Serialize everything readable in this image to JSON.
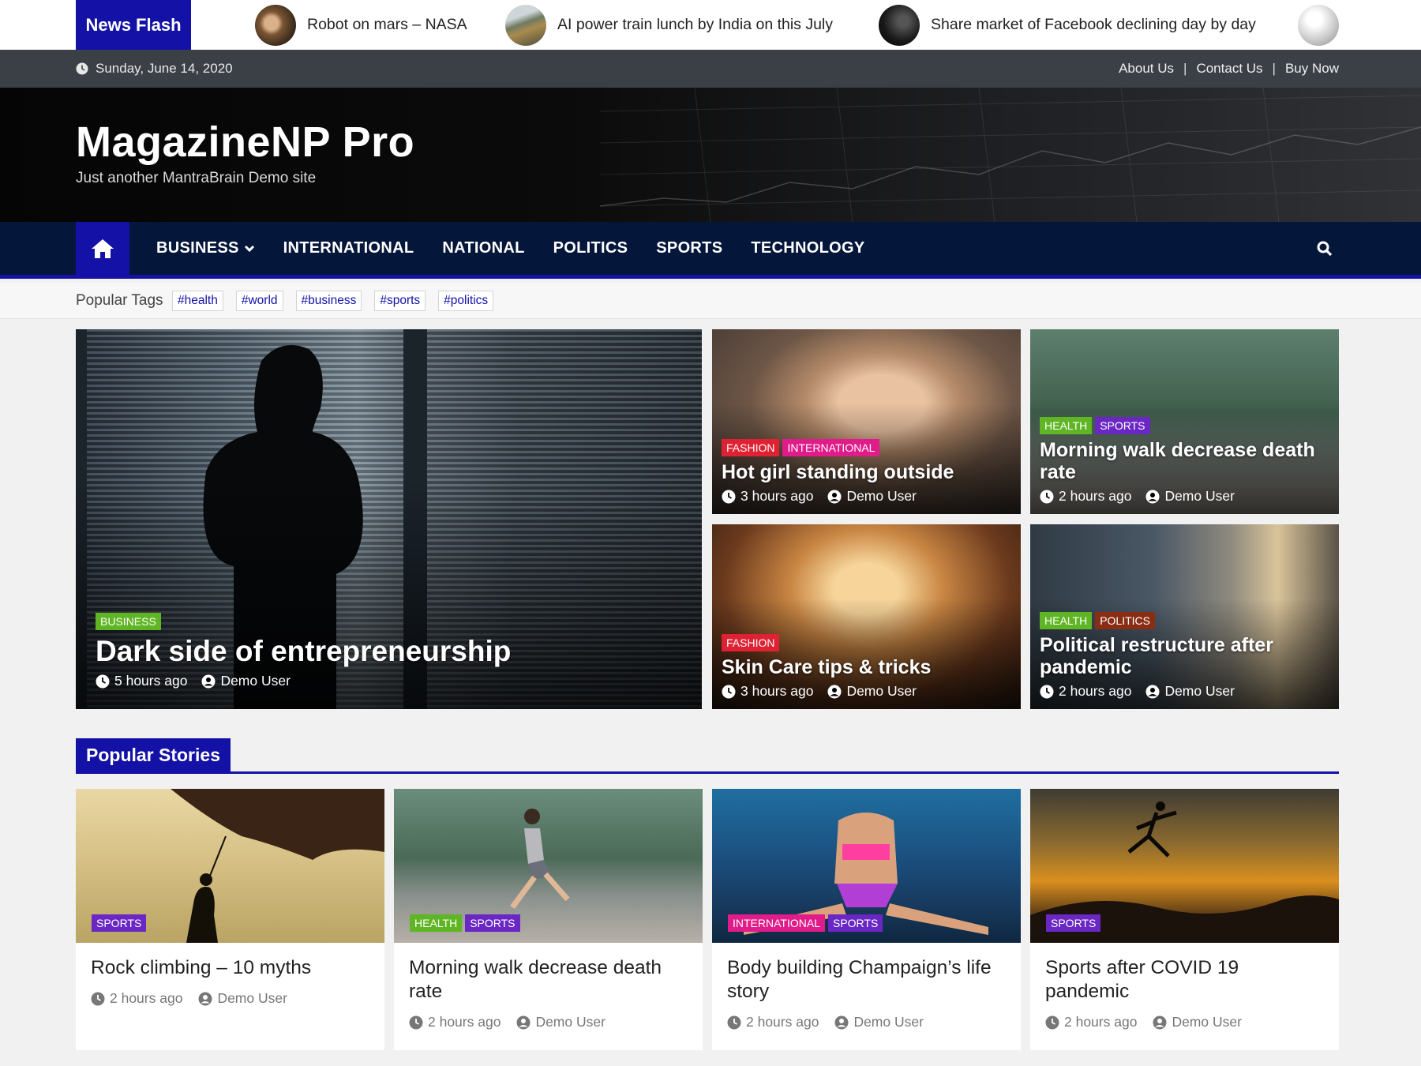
{
  "flash": {
    "label": "News Flash",
    "items": [
      {
        "title": "Robot on mars – NASA",
        "thumb_icon": "mars-rover-thumb"
      },
      {
        "title": "AI power train lunch by India on this July",
        "thumb_icon": "train-thumb"
      },
      {
        "title": "Share market of Facebook declining day by day",
        "thumb_icon": "stock-thumb"
      }
    ]
  },
  "topbar": {
    "date": "Sunday, June 14, 2020",
    "links": [
      "About Us",
      "Contact Us",
      "Buy Now"
    ],
    "separator": "|"
  },
  "header": {
    "title": "MagazineNP Pro",
    "description": "Just another MantraBrain Demo site"
  },
  "nav": {
    "items": [
      "BUSINESS",
      "INTERNATIONAL",
      "NATIONAL",
      "POLITICS",
      "SPORTS",
      "TECHNOLOGY"
    ]
  },
  "tags": {
    "label": "Popular Tags",
    "items": [
      "#health",
      "#world",
      "#business",
      "#sports",
      "#politics"
    ]
  },
  "featured": [
    {
      "title": "Dark side of entrepreneurship",
      "categories": [
        "BUSINESS"
      ],
      "time": "5 hours ago",
      "author": "Demo User"
    },
    {
      "title": "Hot girl standing outside",
      "categories": [
        "FASHION",
        "INTERNATIONAL"
      ],
      "time": "3 hours ago",
      "author": "Demo User"
    },
    {
      "title": "Morning walk decrease death rate",
      "categories": [
        "HEALTH",
        "SPORTS"
      ],
      "time": "2 hours ago",
      "author": "Demo User"
    },
    {
      "title": "Skin Care tips & tricks",
      "categories": [
        "FASHION"
      ],
      "time": "3 hours ago",
      "author": "Demo User"
    },
    {
      "title": "Political restructure after pandemic",
      "categories": [
        "HEALTH",
        "POLITICS"
      ],
      "time": "2 hours ago",
      "author": "Demo User"
    }
  ],
  "popular": {
    "title": "Popular Stories",
    "items": [
      {
        "title": "Rock climbing – 10 myths",
        "categories": [
          "SPORTS"
        ],
        "time": "2 hours ago",
        "author": "Demo User"
      },
      {
        "title": "Morning walk decrease death rate",
        "categories": [
          "HEALTH",
          "SPORTS"
        ],
        "time": "2 hours ago",
        "author": "Demo User"
      },
      {
        "title": "Body building Champaign’s life story",
        "categories": [
          "INTERNATIONAL",
          "SPORTS"
        ],
        "time": "2 hours ago",
        "author": "Demo User"
      },
      {
        "title": "Sports after COVID 19 pandemic",
        "categories": [
          "SPORTS"
        ],
        "time": "2 hours ago",
        "author": "Demo User"
      }
    ]
  },
  "colors": {
    "accent": "#1411a6",
    "nav_bg": "#05163b",
    "topbar_bg": "#3b4047",
    "health_business": "#5fb524",
    "fashion": "#df2233",
    "international": "#e01b8a",
    "sports": "#6a27c4",
    "politics": "#8a2d15"
  }
}
